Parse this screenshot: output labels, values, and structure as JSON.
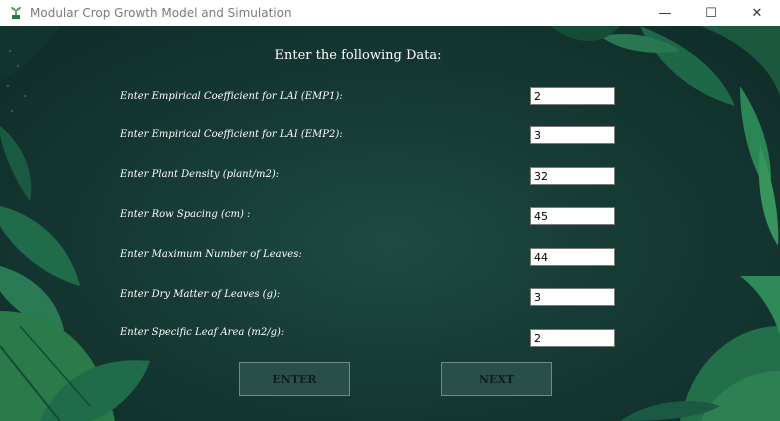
{
  "window": {
    "title": "Modular Crop Growth Model and Simulation",
    "controls": {
      "minimize": "—",
      "maximize": "☐",
      "close": "✕"
    }
  },
  "form": {
    "heading": "Enter the following Data:",
    "fields": [
      {
        "label": "Enter Empirical Coefficient for LAI (EMP1):",
        "value": "2"
      },
      {
        "label": "Enter Empirical Coefficient for LAI (EMP2):",
        "value": "3"
      },
      {
        "label": "Enter Plant Density (plant/m2):",
        "value": "32"
      },
      {
        "label": "Enter Row Spacing (cm) :",
        "value": "45"
      },
      {
        "label": "Enter Maximum Number of Leaves:",
        "value": "44"
      },
      {
        "label": "Enter Dry Matter of Leaves (g):",
        "value": "3"
      },
      {
        "label": "Enter Specific Leaf Area (m2/g):",
        "value": "2"
      }
    ],
    "buttons": {
      "enter": "ENTER",
      "next": "NEXT"
    }
  },
  "colors": {
    "background": "#163a35",
    "leaf": "#1f6b4a",
    "button": "#2a4f4b"
  }
}
